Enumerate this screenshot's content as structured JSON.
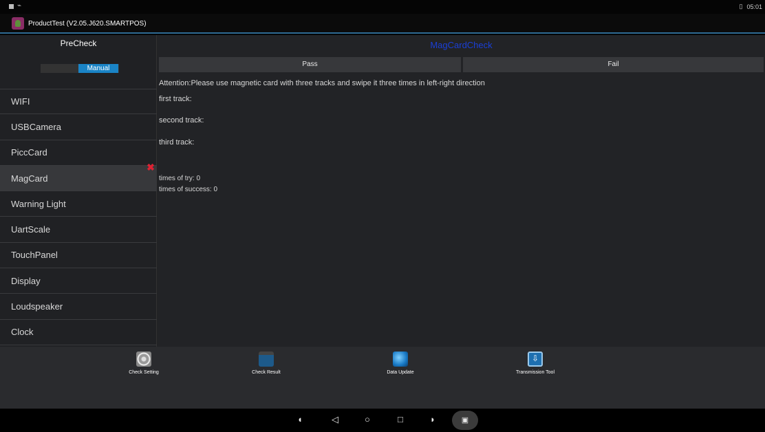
{
  "status_bar": {
    "icons": [
      "notification-square-icon",
      "usb-icon"
    ],
    "time": "05:01"
  },
  "app": {
    "title": "ProductTest (V2.05.J620.SMARTPOS)"
  },
  "sidebar": {
    "header": "PreCheck",
    "mode_label": "Manual",
    "items": [
      {
        "label": "WIFI"
      },
      {
        "label": "USBCamera"
      },
      {
        "label": "PiccCard"
      },
      {
        "label": "MagCard",
        "active": true,
        "status": "fail"
      },
      {
        "label": "Warning Light"
      },
      {
        "label": "UartScale"
      },
      {
        "label": "TouchPanel"
      },
      {
        "label": "Display"
      },
      {
        "label": "Loudspeaker"
      },
      {
        "label": "Clock"
      }
    ]
  },
  "content": {
    "title": "MagCardCheck",
    "title_color": "#1a3fd6",
    "pass_label": "Pass",
    "fail_label": "Fail",
    "attention": "Attention:Please use magnetic card with three tracks and swipe it three times in left-right direction",
    "first_track": "first track:",
    "second_track": "second track:",
    "third_track": "third track:",
    "times_of_try": "times of try: 0",
    "times_of_success": "times of success: 0"
  },
  "toolbar": {
    "check_setting": "Check Setting",
    "check_result": "Check Result",
    "data_update": "Data Update",
    "transmission_tool": "Transmission Tool"
  },
  "navbar": {
    "icons": [
      "volume-down-icon",
      "back-icon",
      "home-icon",
      "recents-icon",
      "volume-up-icon",
      "screenshot-icon"
    ]
  }
}
